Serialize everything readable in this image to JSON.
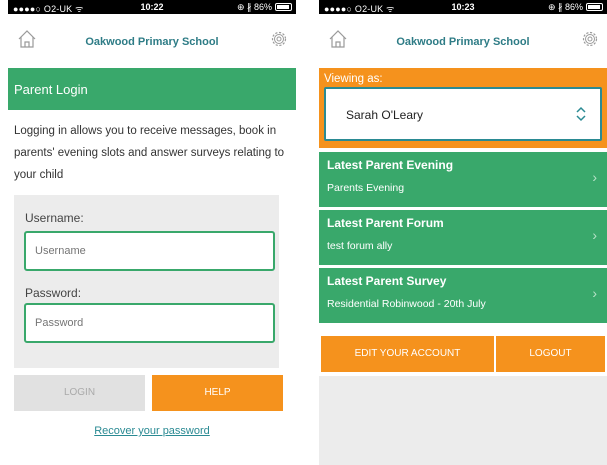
{
  "status_bar": {
    "left": {
      "carrier": "●●●●○ O2-UK ᯤ"
    },
    "screen1_time": "10:22",
    "screen2_time": "10:23",
    "right": "⊕ ∦ 86%"
  },
  "app": {
    "title": "Oakwood Primary School"
  },
  "login": {
    "header": "Parent Login",
    "intro": "Logging in allows you to receive messages, book in parents' evening slots and answer surveys relating to your child",
    "username_label": "Username:",
    "username_placeholder": "Username",
    "password_label": "Password:",
    "password_placeholder": "Password",
    "login_button": "LOGIN",
    "help_button": "HELP",
    "recover_link": "Recover your password"
  },
  "dashboard": {
    "viewing_label": "Viewing as:",
    "selected_child": "Sarah O'Leary",
    "cards": [
      {
        "title": "Latest Parent Evening",
        "subtitle": "Parents Evening"
      },
      {
        "title": "Latest Parent Forum",
        "subtitle": "test forum ally"
      },
      {
        "title": "Latest Parent Survey",
        "subtitle": "Residential Robinwood - 20th July"
      }
    ],
    "edit_button": "EDIT YOUR ACCOUNT",
    "logout_button": "LOGOUT"
  },
  "icons": {
    "home": "home-icon",
    "settings": "gear-icon",
    "select_arrows": "up-down-chevron-icon",
    "card_chevron": "chevron-right-icon"
  },
  "colors": {
    "green": "#39a86b",
    "orange": "#f5921d",
    "teal": "#2a8a93",
    "grey": "#ececec"
  }
}
